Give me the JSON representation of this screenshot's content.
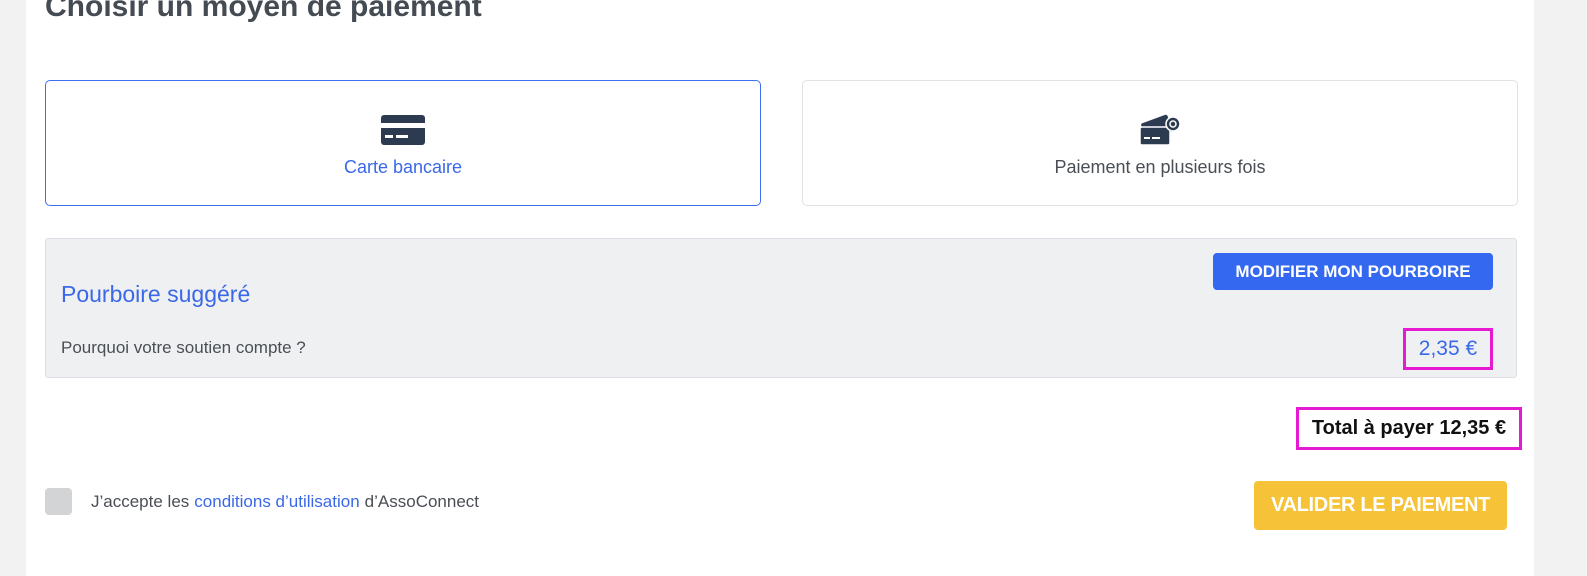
{
  "page": {
    "title": "Choisir un moyen de paiement"
  },
  "payment_methods": [
    {
      "label": "Carte bancaire",
      "icon": "credit-card-icon",
      "selected": true
    },
    {
      "label": "Paiement en plusieurs fois",
      "icon": "installment-cards-icon",
      "selected": false
    }
  ],
  "tip": {
    "title": "Pourboire suggéré",
    "why_label": "Pourquoi votre soutien compte ?",
    "modify_label": "MODIFIER MON POURBOIRE",
    "amount": "2,35 €"
  },
  "total": {
    "label": "Total à payer 12,35 €"
  },
  "terms": {
    "prefix": "J’accepte les",
    "link_label": "conditions d’utilisation",
    "suffix": "d’AssoConnect",
    "checked": false
  },
  "actions": {
    "pay_label": "VALIDER LE PAIEMENT"
  },
  "colors": {
    "accent": "#3a68e8",
    "primary_button": "#3468f0",
    "pay_button": "#f6c237",
    "highlight": "#e61ad0",
    "icon": "#2d3b50"
  }
}
